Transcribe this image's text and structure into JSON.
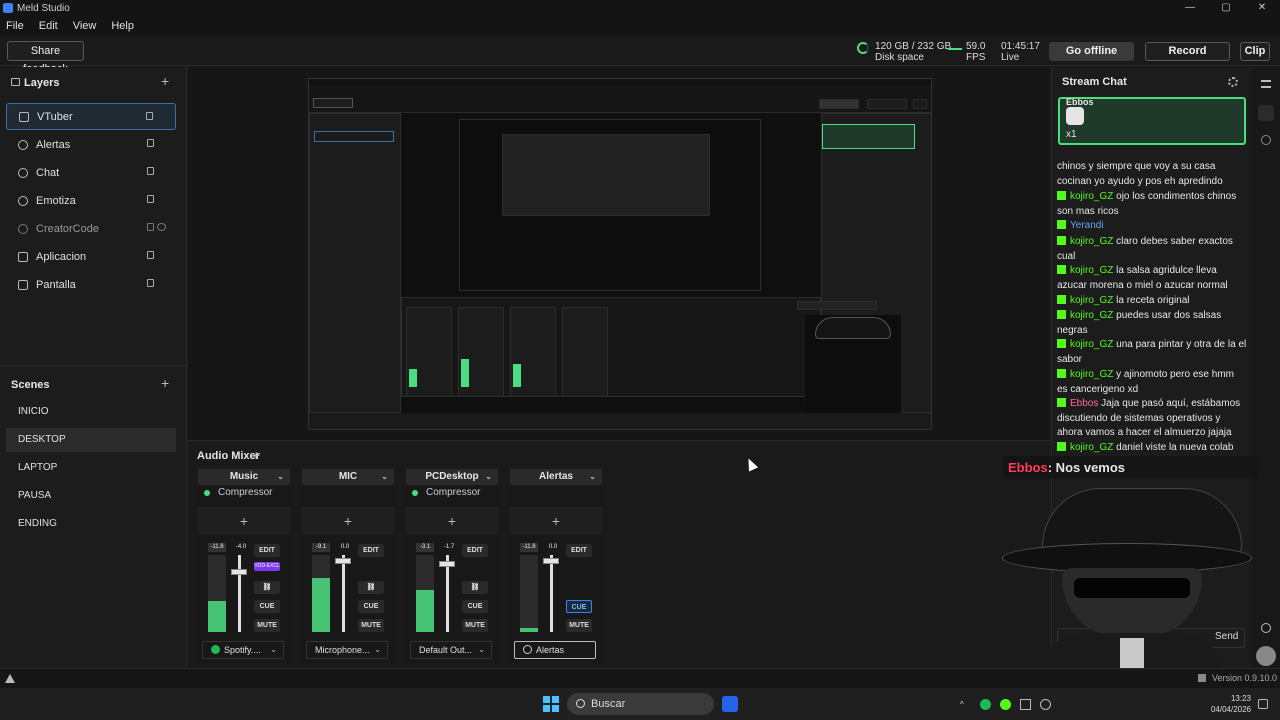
{
  "window": {
    "title": "Meld Studio",
    "controls": [
      "—",
      "▢",
      "✕"
    ]
  },
  "menu": [
    "File",
    "Edit",
    "View",
    "Help"
  ],
  "toolbar": {
    "feedback": "Share feedback",
    "disk_value": "120 GB / 232 GB",
    "disk_label": "Disk space",
    "fps_value": "59.0",
    "fps_label": "FPS",
    "time_value": "01:45:17",
    "time_label": "Live",
    "go_offline": "Go offline",
    "record": "Record",
    "clip": "Clip"
  },
  "layers": {
    "title": "Layers",
    "items": [
      {
        "label": "VTuber",
        "selected": true
      },
      {
        "label": "Alertas"
      },
      {
        "label": "Chat"
      },
      {
        "label": "Emotiza"
      },
      {
        "label": "CreatorCode",
        "dim": true
      },
      {
        "label": "Aplicacion"
      },
      {
        "label": "Pantalla"
      }
    ]
  },
  "scenes": {
    "title": "Scenes",
    "items": [
      "INICIO",
      "DESKTOP",
      "LAPTOP",
      "PAUSA",
      "ENDING"
    ],
    "selected": "DESKTOP"
  },
  "mixer": {
    "title": "Audio Mixer",
    "channels": [
      {
        "name": "Music",
        "filter": "Compressor",
        "db": "-11.8",
        "gain": "-4.0",
        "level": 0.4,
        "fader": 0.78,
        "vod": "VOD-EXCL",
        "source": "Spotify....",
        "buttons": [
          "EDIT",
          "CUE",
          "MUTE"
        ]
      },
      {
        "name": "MIC",
        "filter": "",
        "db": "-9.1",
        "gain": "0.0",
        "level": 0.7,
        "fader": 0.92,
        "source": "Microphone...",
        "buttons": [
          "EDIT",
          "CUE",
          "MUTE"
        ]
      },
      {
        "name": "PCDesktop",
        "filter": "Compressor",
        "db": "-3.1",
        "gain": "-1.7",
        "level": 0.55,
        "fader": 0.88,
        "source": "Default Out...",
        "buttons": [
          "EDIT",
          "CUE",
          "MUTE"
        ]
      },
      {
        "name": "Alertas",
        "filter": "",
        "db": "-11.8",
        "gain": "0.0",
        "level": 0.05,
        "fader": 0.92,
        "source": "Alertas",
        "buttons": [
          "EDIT",
          "CUE",
          "MUTE"
        ],
        "cue_active": true
      }
    ]
  },
  "chat": {
    "title": "Stream Chat",
    "gift_user": "Ebbos",
    "gift_count": "x1",
    "messages": [
      {
        "user": "",
        "text": "chinos y siempre que voy a su casa cocinan yo ayudo y pos eh apredindo"
      },
      {
        "user": "kojiro_GZ",
        "text": "ojo los condimentos chinos son mas ricos"
      },
      {
        "user": "Yerandi",
        "text": "",
        "style": "u3"
      },
      {
        "user": "kojiro_GZ",
        "text": "claro debes saber exactos cual"
      },
      {
        "user": "kojiro_GZ",
        "text": "la salsa agridulce lleva azucar morena o miel o azucar normal"
      },
      {
        "user": "kojiro_GZ",
        "text": "la receta original"
      },
      {
        "user": "kojiro_GZ",
        "text": "puedes usar dos salsas negras"
      },
      {
        "user": "kojiro_GZ",
        "text": "una para pintar y otra de la el sabor"
      },
      {
        "user": "kojiro_GZ",
        "text": "y ajinomoto pero ese hmm es cancerigeno xd"
      },
      {
        "user": "Ebbos",
        "text": "Jaja que pasó aquí, estábamos discutiendo de sistemas operativos y ahora vamos a hacer el almuerzo jajaja",
        "style": "u2"
      },
      {
        "user": "kojiro_GZ",
        "text": "daniel viste la nueva colab"
      }
    ],
    "send": "Send"
  },
  "overlay": {
    "user": "Ebbos",
    "text": ": Nos vemos"
  },
  "status": {
    "version": "Version 0.9.10.0"
  },
  "taskbar": {
    "search": "Buscar",
    "time": "13:23",
    "date": "04/04/2026"
  }
}
